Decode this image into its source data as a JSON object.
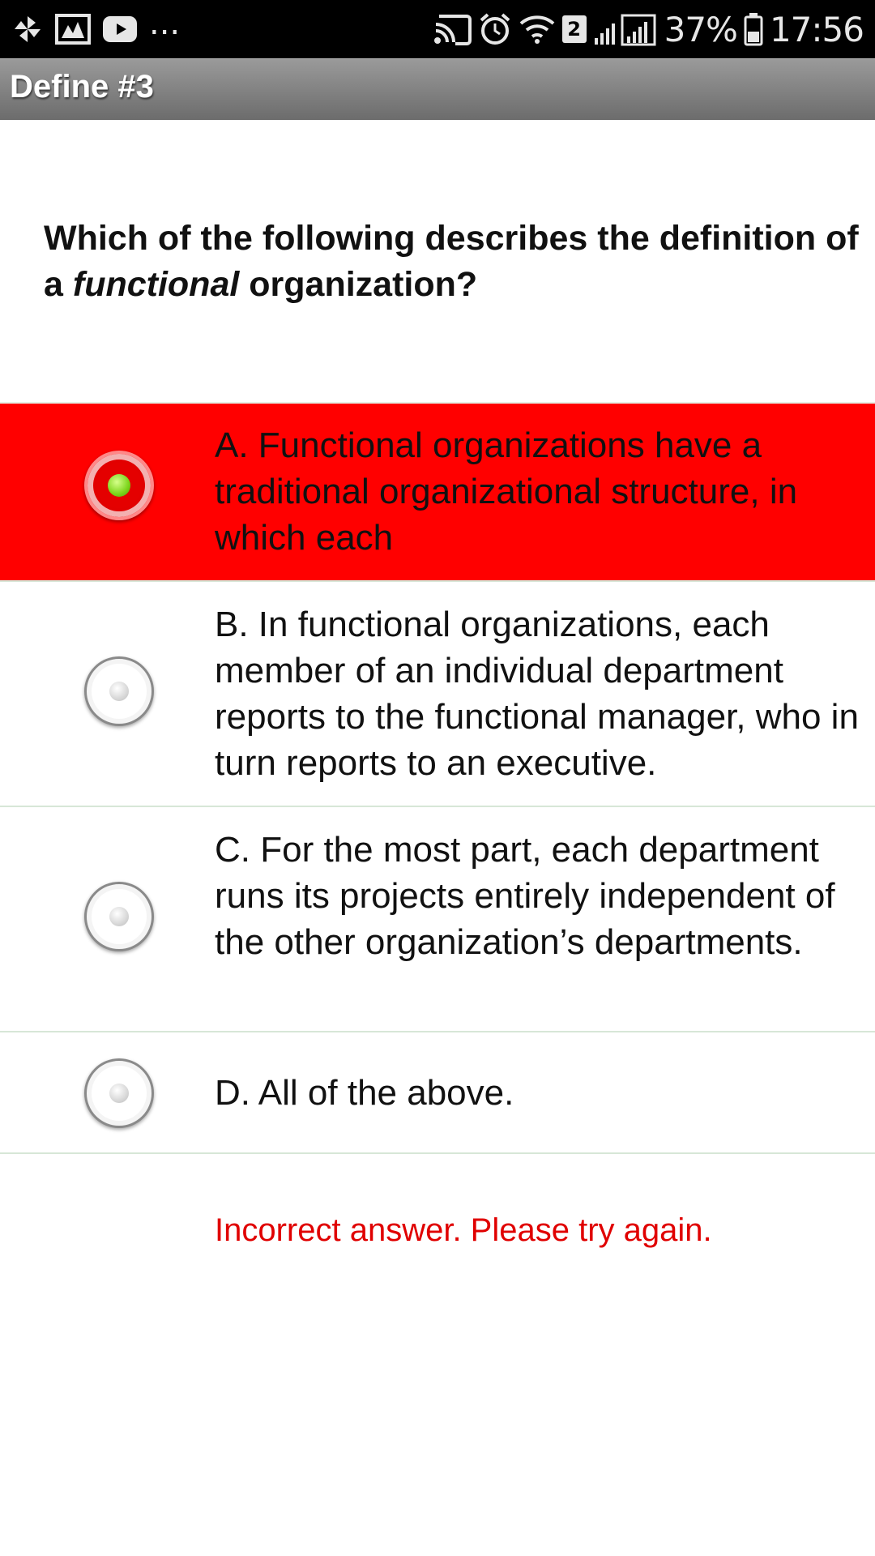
{
  "status_bar": {
    "icons_left": [
      "pinwheel-icon",
      "gallery-icon",
      "youtube-icon"
    ],
    "more": "...",
    "icons_right": [
      "cast-icon",
      "alarm-icon",
      "wifi-icon",
      "signal-icon",
      "battery-icon"
    ],
    "sim_label": "2",
    "battery": "37%",
    "time": "17:56"
  },
  "header": {
    "title": "Define #3"
  },
  "question": {
    "prefix": "Which of the following describes the definition of a ",
    "emphasis": "functional",
    "suffix": " organization?"
  },
  "options": [
    {
      "label": "A. Functional organizations have a traditional organizational structure, in which each",
      "selected": true
    },
    {
      "label": "B. In functional organizations, each member of an individual department reports to the functional manager, who in turn reports to an executive.",
      "selected": false
    },
    {
      "label": "C. For the most part, each department runs its projects entirely independent of the other organization’s departments.",
      "selected": false
    },
    {
      "label": "D. All of the above.",
      "selected": false
    }
  ],
  "feedback": "Incorrect answer. Please try again.",
  "colors": {
    "selected_background": "#ff0000",
    "feedback_text": "#e00000",
    "header_gradient_top": "#9a9a9a",
    "header_gradient_bottom": "#6c6c6c"
  }
}
